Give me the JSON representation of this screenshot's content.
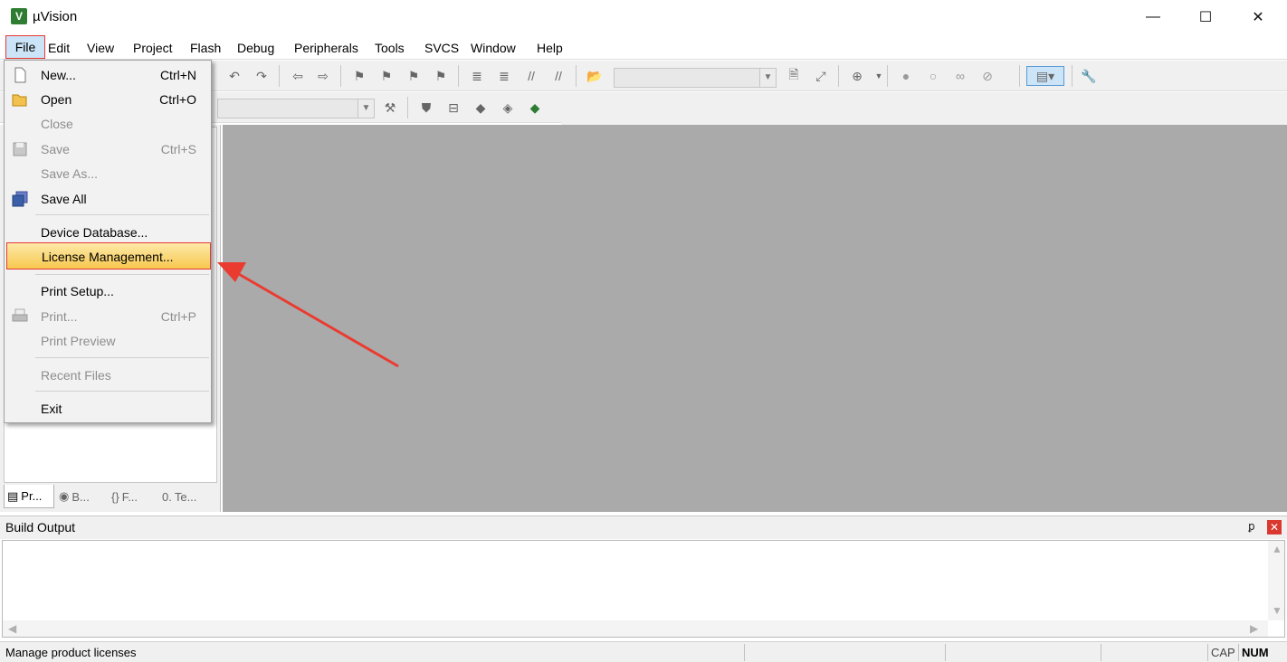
{
  "window": {
    "title": "µVision",
    "min_glyph": "—",
    "max_glyph": "☐",
    "close_glyph": "✕"
  },
  "menubar": [
    "File",
    "Edit",
    "View",
    "Project",
    "Flash",
    "Debug",
    "Peripherals",
    "Tools",
    "SVCS",
    "Window",
    "Help"
  ],
  "file_menu": {
    "items": [
      {
        "label": "New...",
        "shortcut": "Ctrl+N",
        "enabled": true
      },
      {
        "label": "Open",
        "shortcut": "Ctrl+O",
        "enabled": true
      },
      {
        "label": "Close",
        "shortcut": "",
        "enabled": false
      },
      {
        "label": "Save",
        "shortcut": "Ctrl+S",
        "enabled": false
      },
      {
        "label": "Save As...",
        "shortcut": "",
        "enabled": false
      },
      {
        "label": "Save All",
        "shortcut": "",
        "enabled": true
      },
      {
        "label": "Device Database...",
        "shortcut": "",
        "enabled": true
      },
      {
        "label": "License Management...",
        "shortcut": "",
        "enabled": true,
        "highlighted": true
      },
      {
        "label": "Print Setup...",
        "shortcut": "",
        "enabled": true
      },
      {
        "label": "Print...",
        "shortcut": "Ctrl+P",
        "enabled": false
      },
      {
        "label": "Print Preview",
        "shortcut": "",
        "enabled": false
      },
      {
        "label": "Recent Files",
        "shortcut": "",
        "enabled": false
      },
      {
        "label": "Exit",
        "shortcut": "",
        "enabled": true
      }
    ]
  },
  "panel_tabs": [
    "Pr...",
    "B...",
    "F...",
    "Te..."
  ],
  "build_output": {
    "title": "Build Output",
    "pin_glyph": "📌",
    "close_glyph": "✕"
  },
  "statusbar": {
    "text": "Manage product licenses",
    "cap": "CAP",
    "num": "NUM"
  },
  "colors": {
    "editor_bg": "#aaaaaa",
    "highlight_annotation": "#e53935",
    "menu_highlight": "#f7c84f"
  },
  "icons": {
    "new": "new-file-icon",
    "open": "open-folder-icon",
    "save": "save-icon",
    "save_all": "save-all-icon",
    "print": "print-icon"
  }
}
